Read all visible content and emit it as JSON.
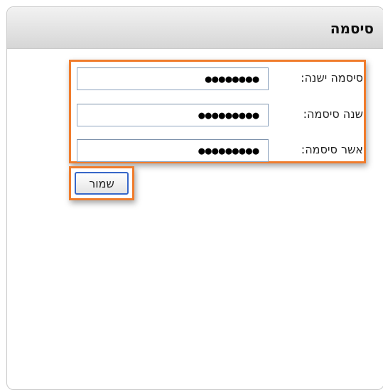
{
  "panel": {
    "title": "סיסמה"
  },
  "form": {
    "fields": [
      {
        "label": "סיסמה ישנה:",
        "value": "●●●●●●●●"
      },
      {
        "label": "שנה סיסמה:",
        "value": "●●●●●●●●●"
      },
      {
        "label": "אשר סיסמה:",
        "value": "●●●●●●●●●"
      }
    ],
    "save_label": "שמור"
  },
  "colors": {
    "highlight": "#f07c2c",
    "button_border": "#3767c8"
  }
}
